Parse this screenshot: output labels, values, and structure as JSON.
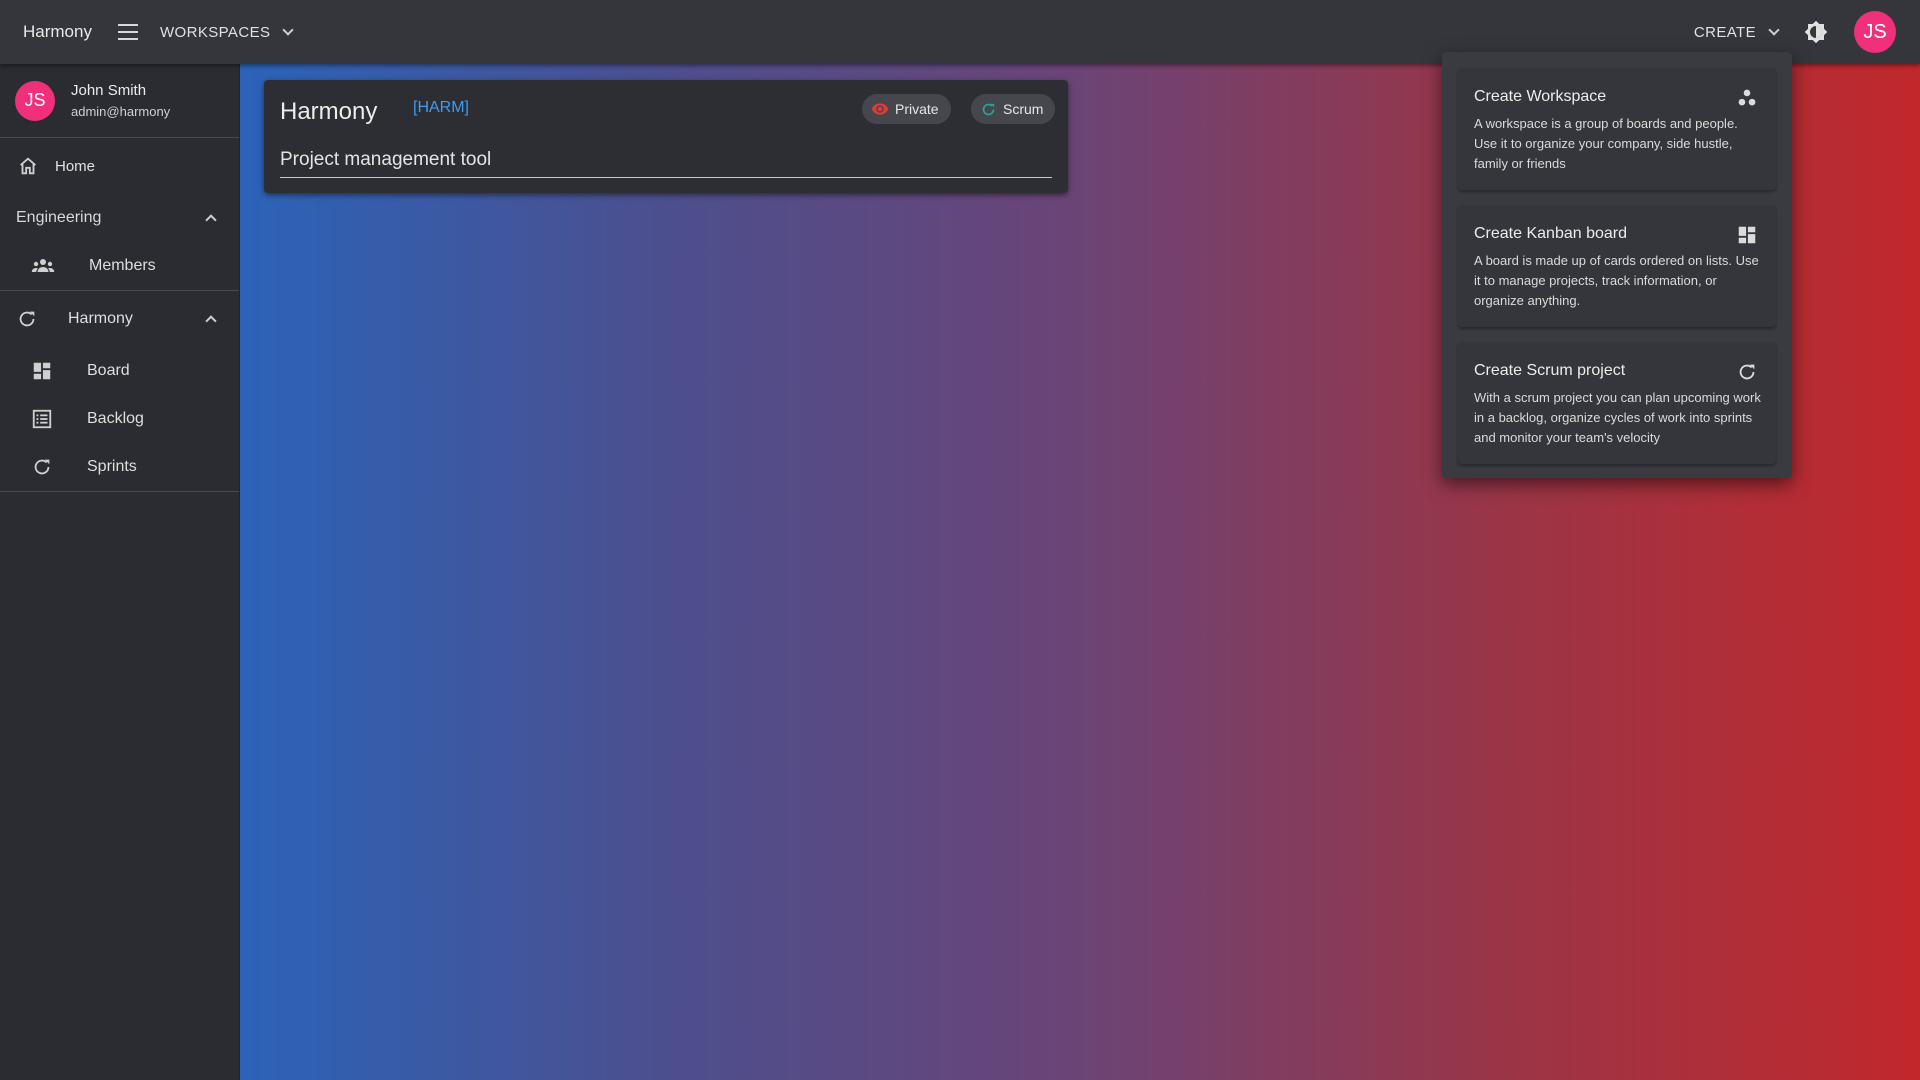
{
  "topbar": {
    "app_title": "Harmony",
    "workspaces_label": "WORKSPACES",
    "create_label": "CREATE",
    "avatar_initials": "JS"
  },
  "sidebar": {
    "user": {
      "initials": "JS",
      "name": "John Smith",
      "email": "admin@harmony"
    },
    "home_label": "Home",
    "workspace": {
      "name": "Engineering",
      "items": [
        {
          "label": "Members",
          "icon": "people-icon"
        }
      ]
    },
    "project": {
      "name": "Harmony",
      "items": [
        {
          "label": "Board",
          "icon": "dashboard-icon"
        },
        {
          "label": "Backlog",
          "icon": "list-icon"
        },
        {
          "label": "Sprints",
          "icon": "sync-icon"
        }
      ]
    }
  },
  "project_card": {
    "title": "Harmony",
    "key": "[HARM]",
    "visibility_label": "Private",
    "type_label": "Scrum",
    "description": "Project management tool"
  },
  "create_menu": {
    "items": [
      {
        "title": "Create Workspace",
        "icon": "workspaces-icon",
        "description": "A workspace is a group of boards and people. Use it to organize your company, side hustle, family or friends"
      },
      {
        "title": "Create Kanban board",
        "icon": "dashboard-icon",
        "description": "A board is made up of cards ordered on lists. Use it to manage projects, track information, or organize anything."
      },
      {
        "title": "Create Scrum project",
        "icon": "sync-icon",
        "description": "With a scrum project you can plan upcoming work in a backlog, organize cycles of work into sprints and monitor your team's velocity"
      }
    ]
  },
  "colors": {
    "accent_pink": "#f0307a",
    "link_blue": "#3f9bf0",
    "private_red": "#e53935",
    "scrum_green": "#26a69a",
    "gradient_start": "#2b63b8",
    "gradient_end": "#c1282c"
  }
}
